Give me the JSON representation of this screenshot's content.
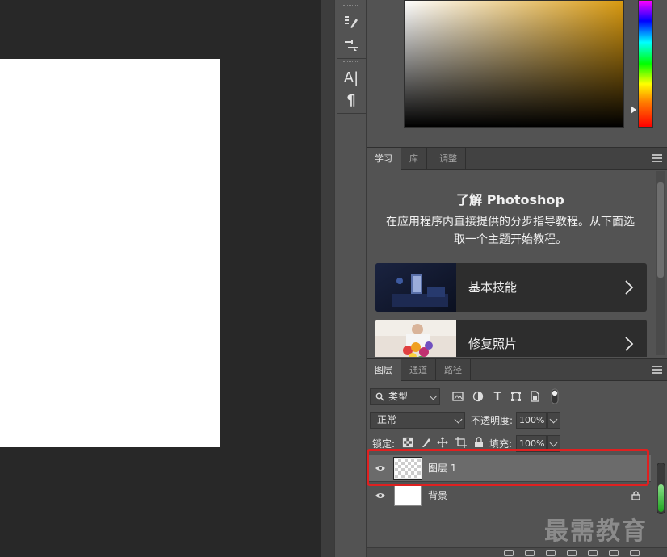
{
  "colors": {
    "canvas_bg": "#282828",
    "document": "#ffffff",
    "panel_bg": "#535353",
    "highlight": "#e02020",
    "selected_layer": "#6b6b6b"
  },
  "toolstrip": {
    "icons": [
      "brush-settings-icon",
      "brush-preset-icon",
      "character-icon",
      "paragraph-icon"
    ],
    "character_label": "A|",
    "paragraph_label": "¶"
  },
  "learn_tabs": [
    {
      "label": "学习",
      "active": true
    },
    {
      "label": "库",
      "active": false
    },
    {
      "label": "调整",
      "active": false
    }
  ],
  "learn": {
    "title": "了解 Photoshop",
    "description": "在应用程序内直接提供的分步指导教程。从下面选取一个主题开始教程。",
    "lessons": [
      {
        "label": "基本技能"
      },
      {
        "label": "修复照片"
      }
    ]
  },
  "layers_tabs": [
    {
      "label": "图层",
      "active": true
    },
    {
      "label": "通道",
      "active": false
    },
    {
      "label": "路径",
      "active": false
    }
  ],
  "layers": {
    "filter_type": "类型",
    "blend_mode": "正常",
    "opacity_label": "不透明度:",
    "opacity_value": "100%",
    "lock_label": "锁定:",
    "fill_label": "填充:",
    "fill_value": "100%",
    "filter_icons": [
      "image-filter-icon",
      "adjustment-filter-icon",
      "type-filter-icon",
      "shape-filter-icon",
      "smart-object-filter-icon",
      "filter-toggle-icon"
    ],
    "lock_icons": [
      "lock-transparent-icon",
      "lock-image-icon",
      "lock-position-icon",
      "lock-artboard-icon",
      "lock-all-icon"
    ],
    "items": [
      {
        "name": "图层 1",
        "selected": true,
        "transparent": true,
        "locked": false
      },
      {
        "name": "背景",
        "selected": false,
        "transparent": false,
        "locked": true
      }
    ]
  },
  "watermark": "最需教育"
}
